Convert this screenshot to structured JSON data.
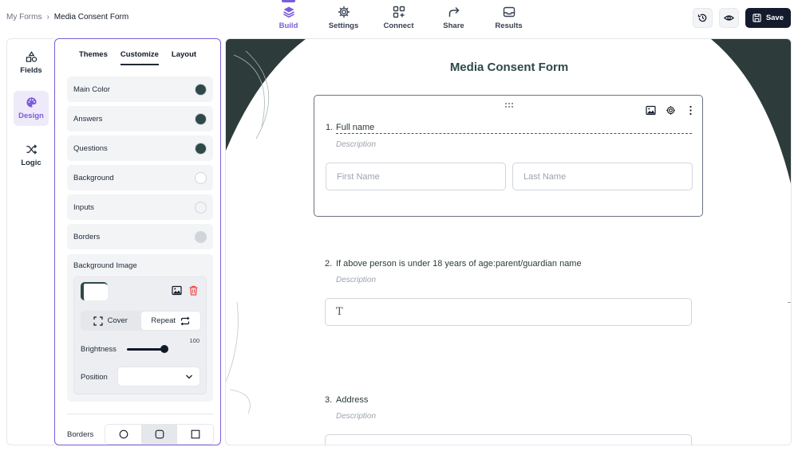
{
  "breadcrumb": {
    "parent": "My Forms",
    "separator": "›",
    "current": "Media Consent Form"
  },
  "nav": [
    {
      "label": "Build",
      "icon": "layers-icon",
      "active": true
    },
    {
      "label": "Settings",
      "icon": "gear-icon"
    },
    {
      "label": "Connect",
      "icon": "connect-icon"
    },
    {
      "label": "Share",
      "icon": "share-icon"
    },
    {
      "label": "Results",
      "icon": "inbox-icon"
    }
  ],
  "actions": {
    "history_icon": "history-icon",
    "preview_icon": "eye-icon",
    "save_label": "Save"
  },
  "rail": {
    "fields": "Fields",
    "design": "Design",
    "logic": "Logic"
  },
  "panel": {
    "tabs": [
      "Themes",
      "Customize",
      "Layout"
    ],
    "active_tab": "Customize",
    "settings": [
      {
        "label": "Main Color",
        "color": "#2e4a48"
      },
      {
        "label": "Answers",
        "color": "#2e4a48"
      },
      {
        "label": "Questions",
        "color": "#2e4a48"
      },
      {
        "label": "Background",
        "color": "#ffffff"
      },
      {
        "label": "Inputs",
        "color": "#f3f4f6"
      },
      {
        "label": "Borders",
        "color": "#d1d5db"
      }
    ],
    "background_image": {
      "title": "Background Image",
      "cover_label": "Cover",
      "repeat_label": "Repeat",
      "brightness_label": "Brightness",
      "brightness_value": "100",
      "position_label": "Position",
      "position_value": ""
    },
    "borders_label": "Borders"
  },
  "form": {
    "title": "Media Consent Form",
    "questions": [
      {
        "number": "1.",
        "label": "Full name",
        "description": "Description",
        "placeholders": [
          "First Name",
          "Last Name"
        ]
      },
      {
        "number": "2.",
        "label": "If above person is under 18 years of age:parent/guardian name",
        "description": "Description",
        "input_icon": "T"
      },
      {
        "number": "3.",
        "label": "Address",
        "description": "Description"
      }
    ]
  },
  "colors": {
    "accent": "#7c5cdb",
    "theme": "#2e4a48",
    "save_bg": "#141b2d"
  }
}
